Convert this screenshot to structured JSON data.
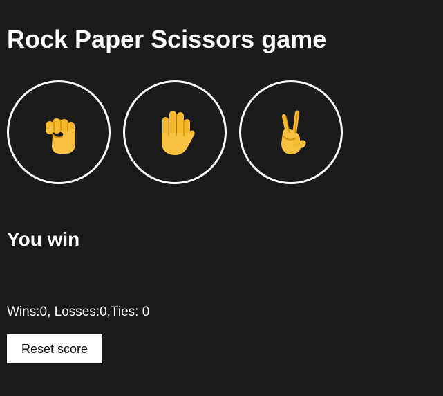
{
  "header": {
    "title": "Rock Paper Scissors game"
  },
  "choices": [
    {
      "name": "rock",
      "icon": "raised-fist-icon",
      "glyph": "✊",
      "color": "#f6b92d"
    },
    {
      "name": "paper",
      "icon": "raised-hand-icon",
      "glyph": "✋",
      "color": "#f6b92d"
    },
    {
      "name": "scissors",
      "icon": "victory-hand-icon",
      "glyph": "✌",
      "color": "#f6b92d"
    }
  ],
  "game": {
    "result": "You win",
    "score_text": "Wins:0, Losses:0,Ties: 0"
  },
  "actions": {
    "reset_label": "Reset score"
  },
  "colors": {
    "background": "#1a1a1a",
    "text": "#ffffff",
    "accent": "#f6b92d",
    "button_background": "#ffffff",
    "button_text": "#111111"
  }
}
